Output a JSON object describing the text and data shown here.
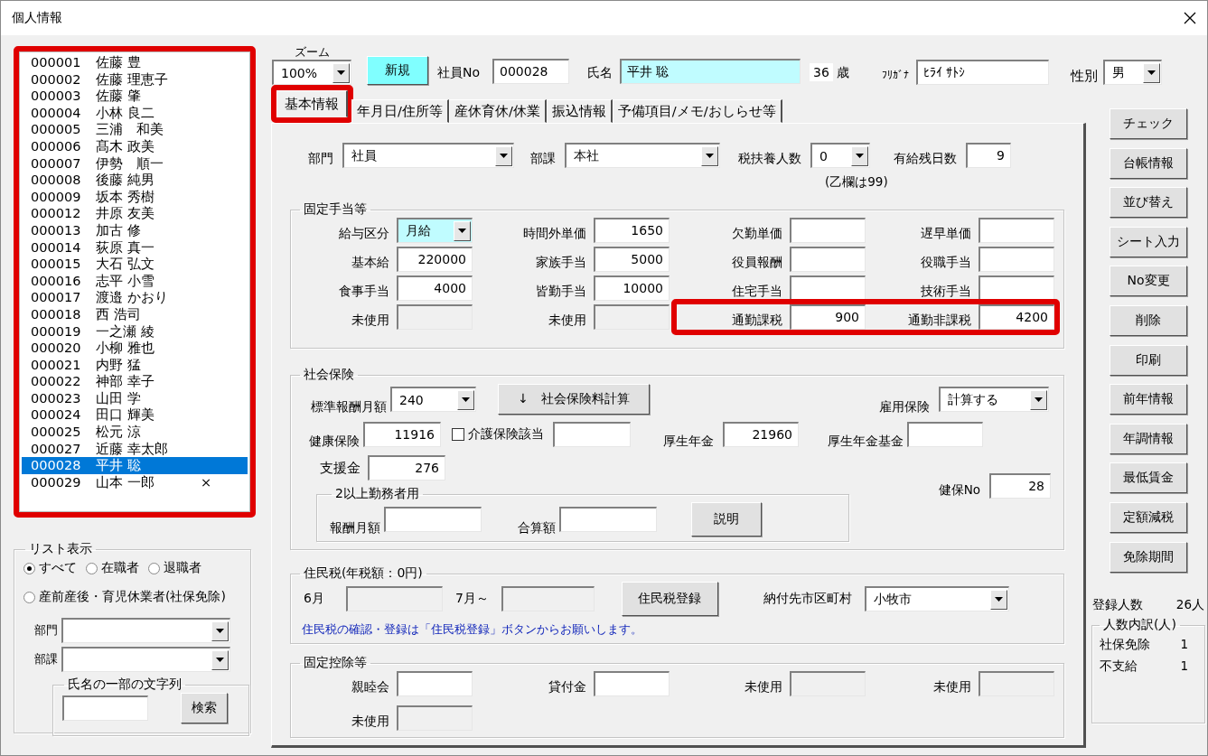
{
  "window": {
    "title": "個人情報"
  },
  "employee_list": {
    "highlighted": true,
    "items": [
      {
        "no": "000001",
        "name": "佐藤 豊",
        "selected": false
      },
      {
        "no": "000002",
        "name": "佐藤 理恵子",
        "selected": false
      },
      {
        "no": "000003",
        "name": "佐藤 肇",
        "selected": false
      },
      {
        "no": "000004",
        "name": "小林 良二",
        "selected": false
      },
      {
        "no": "000005",
        "name": "三浦　和美",
        "selected": false
      },
      {
        "no": "000006",
        "name": "髙木 政美",
        "selected": false
      },
      {
        "no": "000007",
        "name": "伊勢　順一",
        "selected": false
      },
      {
        "no": "000008",
        "name": "後藤 純男",
        "selected": false
      },
      {
        "no": "000009",
        "name": "坂本 秀樹",
        "selected": false
      },
      {
        "no": "000012",
        "name": "井原 友美",
        "selected": false
      },
      {
        "no": "000013",
        "name": "加古 修",
        "selected": false
      },
      {
        "no": "000014",
        "name": "荻原 真一",
        "selected": false
      },
      {
        "no": "000015",
        "name": "大石 弘文",
        "selected": false
      },
      {
        "no": "000016",
        "name": "志平 小雪",
        "selected": false
      },
      {
        "no": "000017",
        "name": "渡邉 かおり",
        "selected": false
      },
      {
        "no": "000018",
        "name": "西 浩司",
        "selected": false
      },
      {
        "no": "000019",
        "name": "一之瀬 綾",
        "selected": false
      },
      {
        "no": "000020",
        "name": "小柳 雅也",
        "selected": false
      },
      {
        "no": "000021",
        "name": "内野 猛",
        "selected": false
      },
      {
        "no": "000022",
        "name": "神部 幸子",
        "selected": false
      },
      {
        "no": "000023",
        "name": "山田 学",
        "selected": false
      },
      {
        "no": "000024",
        "name": "田口 輝美",
        "selected": false
      },
      {
        "no": "000025",
        "name": "松元 涼",
        "selected": false
      },
      {
        "no": "000027",
        "name": "近藤 幸太郎",
        "selected": false
      },
      {
        "no": "000028",
        "name": "平井 聡",
        "selected": true
      },
      {
        "no": "000029",
        "name": "山本 一郎",
        "selected": false,
        "flag": "×"
      }
    ]
  },
  "list_display": {
    "title": "リスト表示",
    "options": [
      {
        "label": "すべて",
        "selected": true
      },
      {
        "label": "在職者",
        "selected": false
      },
      {
        "label": "退職者",
        "selected": false
      },
      {
        "label": "産前産後・育児休業者(社保免除)",
        "selected": false
      }
    ],
    "department": {
      "label": "部門",
      "kind": "combo"
    },
    "section": {
      "label": "部課",
      "kind": "combo"
    },
    "name_search": {
      "title": "氏名の一部の文字列",
      "kind": "text",
      "button": "検索"
    }
  },
  "header": {
    "zoom": {
      "label": "ズーム",
      "value": "100%",
      "kind": "combo"
    },
    "new_button": "新規",
    "employee_no": {
      "label": "社員No",
      "value": "000028",
      "kind": "text"
    },
    "name": {
      "label": "氏名",
      "value": "平井 聡",
      "kind": "text",
      "accent": true
    },
    "age": {
      "value": "36",
      "unit": "歳"
    },
    "furigana": {
      "label": "ﾌﾘｶﾞﾅ",
      "value": "ﾋﾗｲ ｻﾄｼ",
      "kind": "text"
    },
    "gender": {
      "label": "性別",
      "value": "男",
      "kind": "combo"
    }
  },
  "tabs": [
    {
      "label": "基本情報",
      "selected": true,
      "highlighted": true
    },
    {
      "label": "年月日/住所等",
      "selected": false,
      "highlighted": false
    },
    {
      "label": "産休育休/休業",
      "selected": false,
      "highlighted": false
    },
    {
      "label": "振込情報",
      "selected": false,
      "highlighted": false
    },
    {
      "label": "予備項目/メモ/おしらせ等",
      "selected": false,
      "highlighted": false
    }
  ],
  "basic": {
    "fields": [
      {
        "label": "部門",
        "value": "社員",
        "kind": "combo"
      },
      {
        "label": "部課",
        "value": "本社",
        "kind": "combo"
      },
      {
        "label": "税扶養人数",
        "value": "0",
        "kind": "combo"
      },
      {
        "label": "有給残日数",
        "value": "9",
        "kind": "number"
      }
    ],
    "note": "(乙欄は99)"
  },
  "fixed_allowances": {
    "title": "固定手当等",
    "rows": [
      [
        {
          "label": "給与区分",
          "value": "月給",
          "kind": "combo",
          "accent": true
        },
        {
          "label": "時間外単価",
          "value": "1650",
          "kind": "number"
        },
        {
          "label": "欠勤単価",
          "kind": "text"
        },
        {
          "label": "遅早単価",
          "kind": "text"
        }
      ],
      [
        {
          "label": "基本給",
          "value": "220000",
          "kind": "number"
        },
        {
          "label": "家族手当",
          "value": "5000",
          "kind": "number"
        },
        {
          "label": "役員報酬",
          "kind": "text"
        },
        {
          "label": "役職手当",
          "kind": "text"
        }
      ],
      [
        {
          "label": "食事手当",
          "value": "4000",
          "kind": "number"
        },
        {
          "label": "皆勤手当",
          "value": "10000",
          "kind": "number"
        },
        {
          "label": "住宅手当",
          "kind": "text"
        },
        {
          "label": "技術手当",
          "kind": "text"
        }
      ],
      [
        {
          "label": "未使用",
          "kind": "disabled"
        },
        {
          "label": "未使用",
          "kind": "disabled"
        },
        {
          "label": "通勤課税",
          "value": "900",
          "kind": "number",
          "highlighted": true
        },
        {
          "label": "通勤非課税",
          "value": "4200",
          "kind": "number",
          "highlighted": true
        }
      ]
    ]
  },
  "social_insurance": {
    "title": "社会保険",
    "standard_monthly": {
      "label": "標準報酬月額",
      "value": "240",
      "kind": "combo"
    },
    "calc_button": "↓　社会保険料計算",
    "employment_insurance": {
      "label": "雇用保険",
      "value": "計算する",
      "kind": "combo"
    },
    "health_insurance": {
      "label": "健康保険",
      "value": "11916",
      "kind": "number"
    },
    "care_insurance": {
      "label": "介護保険該当",
      "checked": false
    },
    "care_amount": {
      "kind": "text"
    },
    "pension": {
      "label": "厚生年金",
      "value": "21960",
      "kind": "number"
    },
    "pension_fund": {
      "label": "厚生年金基金",
      "kind": "text"
    },
    "support": {
      "label": "支援金",
      "value": "276",
      "kind": "number"
    },
    "multi_employer": {
      "title": "2以上勤務者用",
      "fields": [
        {
          "label": "報酬月額",
          "kind": "text"
        },
        {
          "label": "合算額",
          "kind": "text"
        }
      ],
      "button": "説明"
    },
    "health_no": {
      "label": "健保No",
      "value": "28",
      "kind": "number"
    }
  },
  "resident_tax": {
    "title": "住民税(年税額：0円)",
    "fields": [
      {
        "label": "6月",
        "kind": "disabled"
      },
      {
        "label": "7月～",
        "kind": "disabled"
      }
    ],
    "button": "住民税登録",
    "municipality": {
      "label": "納付先市区町村",
      "value": "小牧市",
      "kind": "combo"
    },
    "note": "住民税の確認・登録は「住民税登録」ボタンからお願いします。"
  },
  "fixed_deductions": {
    "title": "固定控除等",
    "rows": [
      [
        {
          "label": "親睦会",
          "kind": "text"
        },
        {
          "label": "貸付金",
          "kind": "text"
        },
        {
          "label": "未使用",
          "kind": "disabled"
        },
        {
          "label": "未使用",
          "kind": "disabled"
        }
      ],
      [
        {
          "label": "未使用",
          "kind": "disabled"
        }
      ]
    ]
  },
  "actions": [
    "チェック",
    "台帳情報",
    "並び替え",
    "シート入力",
    "No変更",
    "削除",
    "印刷",
    "前年情報",
    "年調情報",
    "最低賃金",
    "定額減税",
    "免除期間"
  ],
  "registered": {
    "label": "登録人数",
    "value": "26人"
  },
  "breakdown": {
    "title": "人数内訳(人)",
    "items": [
      {
        "label": "社保免除",
        "value": "1"
      },
      {
        "label": "不支給",
        "value": "1"
      }
    ]
  }
}
